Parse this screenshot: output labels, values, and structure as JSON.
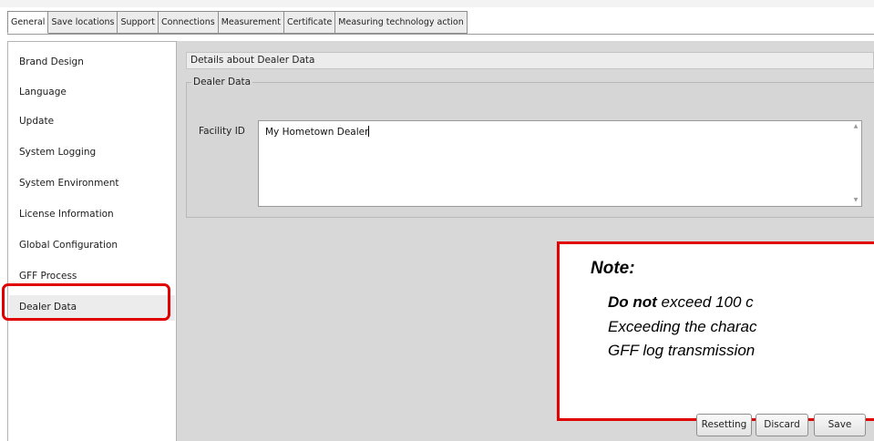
{
  "tabs": [
    "General",
    "Save locations",
    "Support",
    "Connections",
    "Measurement",
    "Certificate",
    "Measuring technology action"
  ],
  "sidebar": {
    "items": [
      "Brand Design",
      "Language",
      "Update",
      "System Logging",
      "System Environment",
      "License Information",
      "Global Configuration",
      "GFF Process",
      "Dealer Data"
    ],
    "selected": "Dealer Data"
  },
  "content": {
    "details_title": "Details about Dealer Data",
    "group_title": "Dealer Data",
    "facility_label": "Facility ID",
    "facility_value": "My Hometown Dealer"
  },
  "note": {
    "title": "Note:",
    "line1_bold": "Do not",
    "line1_rest": " exceed 100 c",
    "line2": "Exceeding the charac",
    "line3": "GFF log transmission"
  },
  "buttons": {
    "resetting": "Resetting",
    "discard": "Discard",
    "save": "Save"
  },
  "colors": {
    "highlight": "#e00000",
    "panel": "#d8d8d8"
  }
}
